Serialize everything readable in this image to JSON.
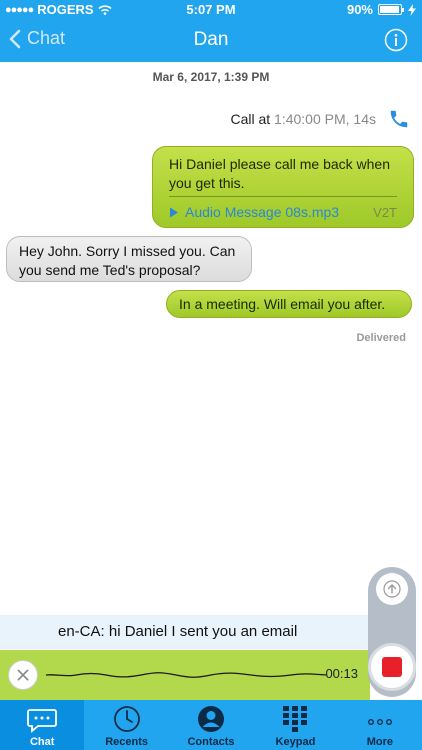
{
  "status_bar": {
    "carrier": "ROGERS",
    "time": "5:07 PM",
    "battery": "90%"
  },
  "nav": {
    "back_label": "Chat",
    "title": "Dan"
  },
  "chat": {
    "date": "Mar 6, 2017, 1:39 PM",
    "call": {
      "label": "Call at",
      "time": "1:40:00 PM, 14s"
    },
    "messages": [
      {
        "side": "out",
        "text": "Hi Daniel please call me back when you get this.",
        "attachment": "Audio Message 08s.mp3",
        "attachment_action": "V2T"
      },
      {
        "side": "in",
        "text": "Hey John. Sorry I missed you. Can you send me Ted's proposal?"
      },
      {
        "side": "out",
        "text": "In a meeting. Will email you after."
      }
    ],
    "delivered": "Delivered"
  },
  "voice_input": {
    "transcript": "en-CA: hi Daniel I sent you an email",
    "timer": "00:13"
  },
  "tabs": [
    {
      "label": "Chat",
      "icon": "chat-icon",
      "active": true
    },
    {
      "label": "Recents",
      "icon": "clock-icon",
      "active": false
    },
    {
      "label": "Contacts",
      "icon": "contacts-icon",
      "active": false
    },
    {
      "label": "Keypad",
      "icon": "keypad-icon",
      "active": false
    },
    {
      "label": "More",
      "icon": "more-icon",
      "active": false
    }
  ],
  "colors": {
    "accent": "#22a5ef",
    "bubble_out": "#a8d030",
    "bubble_in": "#e6e6e6",
    "record": "#e8202a"
  }
}
